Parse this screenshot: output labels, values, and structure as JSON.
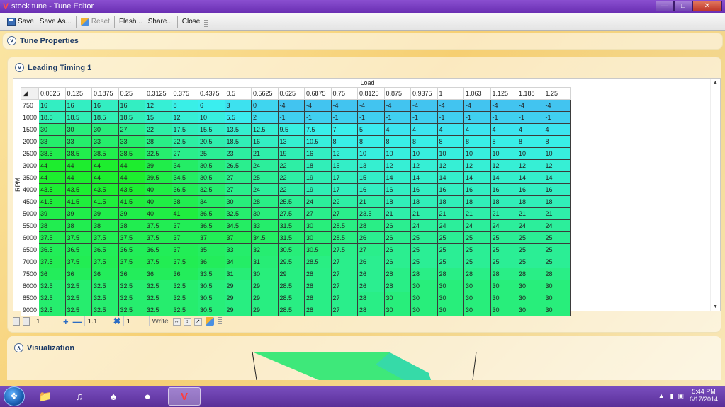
{
  "window": {
    "title": "stock tune - Tune Editor"
  },
  "toolbar": {
    "save": "Save",
    "save_as": "Save As...",
    "reset": "Reset",
    "flash": "Flash...",
    "share": "Share...",
    "close": "Close"
  },
  "tune_properties": {
    "label": "Tune Properties"
  },
  "leading_timing": {
    "label": "Leading Timing 1"
  },
  "table": {
    "x_label": "Load",
    "y_label": "RPM",
    "columns": [
      "0.0625",
      "0.125",
      "0.1875",
      "0.25",
      "0.3125",
      "0.375",
      "0.4375",
      "0.5",
      "0.5625",
      "0.625",
      "0.6875",
      "0.75",
      "0.8125",
      "0.875",
      "0.9375",
      "1",
      "1.063",
      "1.125",
      "1.188",
      "1.25"
    ],
    "rows": [
      {
        "rpm": "750",
        "values": [
          "16",
          "16",
          "16",
          "16",
          "12",
          "8",
          "6",
          "3",
          "0",
          "-4",
          "-4",
          "-4",
          "-4",
          "-4",
          "-4",
          "-4",
          "-4",
          "-4",
          "-4",
          "-4"
        ]
      },
      {
        "rpm": "1000",
        "values": [
          "18.5",
          "18.5",
          "18.5",
          "18.5",
          "15",
          "12",
          "10",
          "5.5",
          "2",
          "-1",
          "-1",
          "-1",
          "-1",
          "-1",
          "-1",
          "-1",
          "-1",
          "-1",
          "-1",
          "-1"
        ]
      },
      {
        "rpm": "1500",
        "values": [
          "30",
          "30",
          "30",
          "27",
          "22",
          "17.5",
          "15.5",
          "13.5",
          "12.5",
          "9.5",
          "7.5",
          "7",
          "5",
          "4",
          "4",
          "4",
          "4",
          "4",
          "4",
          "4"
        ]
      },
      {
        "rpm": "2000",
        "values": [
          "33",
          "33",
          "33",
          "33",
          "28",
          "22.5",
          "20.5",
          "18.5",
          "16",
          "13",
          "10.5",
          "8",
          "8",
          "8",
          "8",
          "8",
          "8",
          "8",
          "8",
          "8"
        ]
      },
      {
        "rpm": "2500",
        "values": [
          "38.5",
          "38.5",
          "38.5",
          "38.5",
          "32.5",
          "27",
          "25",
          "23",
          "21",
          "19",
          "16",
          "12",
          "10",
          "10",
          "10",
          "10",
          "10",
          "10",
          "10",
          "10"
        ]
      },
      {
        "rpm": "3000",
        "values": [
          "44",
          "44",
          "44",
          "44",
          "39",
          "34",
          "30.5",
          "26.5",
          "24",
          "22",
          "18",
          "15",
          "13",
          "12",
          "12",
          "12",
          "12",
          "12",
          "12",
          "12"
        ]
      },
      {
        "rpm": "3500",
        "values": [
          "44",
          "44",
          "44",
          "44",
          "39.5",
          "34.5",
          "30.5",
          "27",
          "25",
          "22",
          "19",
          "17",
          "15",
          "14",
          "14",
          "14",
          "14",
          "14",
          "14",
          "14"
        ]
      },
      {
        "rpm": "4000",
        "values": [
          "43.5",
          "43.5",
          "43.5",
          "43.5",
          "40",
          "36.5",
          "32.5",
          "27",
          "24",
          "22",
          "19",
          "17",
          "16",
          "16",
          "16",
          "16",
          "16",
          "16",
          "16",
          "16"
        ]
      },
      {
        "rpm": "4500",
        "values": [
          "41.5",
          "41.5",
          "41.5",
          "41.5",
          "40",
          "38",
          "34",
          "30",
          "28",
          "25.5",
          "24",
          "22",
          "21",
          "18",
          "18",
          "18",
          "18",
          "18",
          "18",
          "18"
        ]
      },
      {
        "rpm": "5000",
        "values": [
          "39",
          "39",
          "39",
          "39",
          "40",
          "41",
          "36.5",
          "32.5",
          "30",
          "27.5",
          "27",
          "27",
          "23.5",
          "21",
          "21",
          "21",
          "21",
          "21",
          "21",
          "21"
        ]
      },
      {
        "rpm": "5500",
        "values": [
          "38",
          "38",
          "38",
          "38",
          "37.5",
          "37",
          "36.5",
          "34.5",
          "33",
          "31.5",
          "30",
          "28.5",
          "28",
          "26",
          "24",
          "24",
          "24",
          "24",
          "24",
          "24"
        ]
      },
      {
        "rpm": "6000",
        "values": [
          "37.5",
          "37.5",
          "37.5",
          "37.5",
          "37.5",
          "37",
          "37",
          "37",
          "34.5",
          "31.5",
          "30",
          "28.5",
          "26",
          "26",
          "25",
          "25",
          "25",
          "25",
          "25",
          "25"
        ]
      },
      {
        "rpm": "6500",
        "values": [
          "36.5",
          "36.5",
          "36.5",
          "36.5",
          "36.5",
          "37",
          "35",
          "33",
          "32",
          "30.5",
          "30.5",
          "27.5",
          "27",
          "26",
          "25",
          "25",
          "25",
          "25",
          "25",
          "25"
        ]
      },
      {
        "rpm": "7000",
        "values": [
          "37.5",
          "37.5",
          "37.5",
          "37.5",
          "37.5",
          "37.5",
          "36",
          "34",
          "31",
          "29.5",
          "28.5",
          "27",
          "26",
          "26",
          "25",
          "25",
          "25",
          "25",
          "25",
          "25"
        ]
      },
      {
        "rpm": "7500",
        "values": [
          "36",
          "36",
          "36",
          "36",
          "36",
          "36",
          "33.5",
          "31",
          "30",
          "29",
          "28",
          "27",
          "26",
          "28",
          "28",
          "28",
          "28",
          "28",
          "28",
          "28"
        ]
      },
      {
        "rpm": "8000",
        "values": [
          "32.5",
          "32.5",
          "32.5",
          "32.5",
          "32.5",
          "32.5",
          "30.5",
          "29",
          "29",
          "28.5",
          "28",
          "27",
          "26",
          "28",
          "30",
          "30",
          "30",
          "30",
          "30",
          "30"
        ]
      },
      {
        "rpm": "8500",
        "values": [
          "32.5",
          "32.5",
          "32.5",
          "32.5",
          "32.5",
          "32.5",
          "30.5",
          "29",
          "29",
          "28.5",
          "28",
          "27",
          "28",
          "30",
          "30",
          "30",
          "30",
          "30",
          "30",
          "30"
        ]
      },
      {
        "rpm": "9000",
        "values": [
          "32.5",
          "32.5",
          "32.5",
          "32.5",
          "32.5",
          "32.5",
          "30.5",
          "29",
          "29",
          "28.5",
          "28",
          "27",
          "28",
          "30",
          "30",
          "30",
          "30",
          "30",
          "30",
          "30"
        ]
      }
    ]
  },
  "edit_strip": {
    "add_value": "1",
    "multiply_value": "1.1",
    "set_value": "1",
    "write_label": "Write"
  },
  "visualization": {
    "label": "Visualization"
  },
  "taskbar": {
    "time": "5:44 PM",
    "date": "6/17/2014"
  }
}
